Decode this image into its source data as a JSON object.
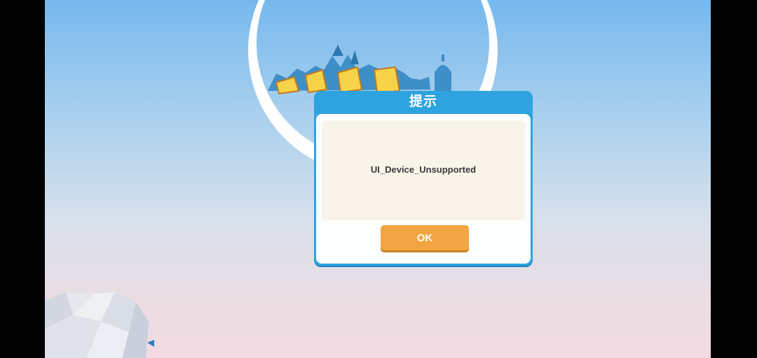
{
  "dialog": {
    "title": "提示",
    "message": "UI_Device_Unsupported",
    "ok_label": "OK"
  },
  "colors": {
    "dialog_border": "#2ea3df",
    "panel_bg": "#f8f4ea",
    "ok_button": "#f2a643",
    "sky_top": "#76b8ee",
    "sky_bottom": "#f2dbe3"
  }
}
